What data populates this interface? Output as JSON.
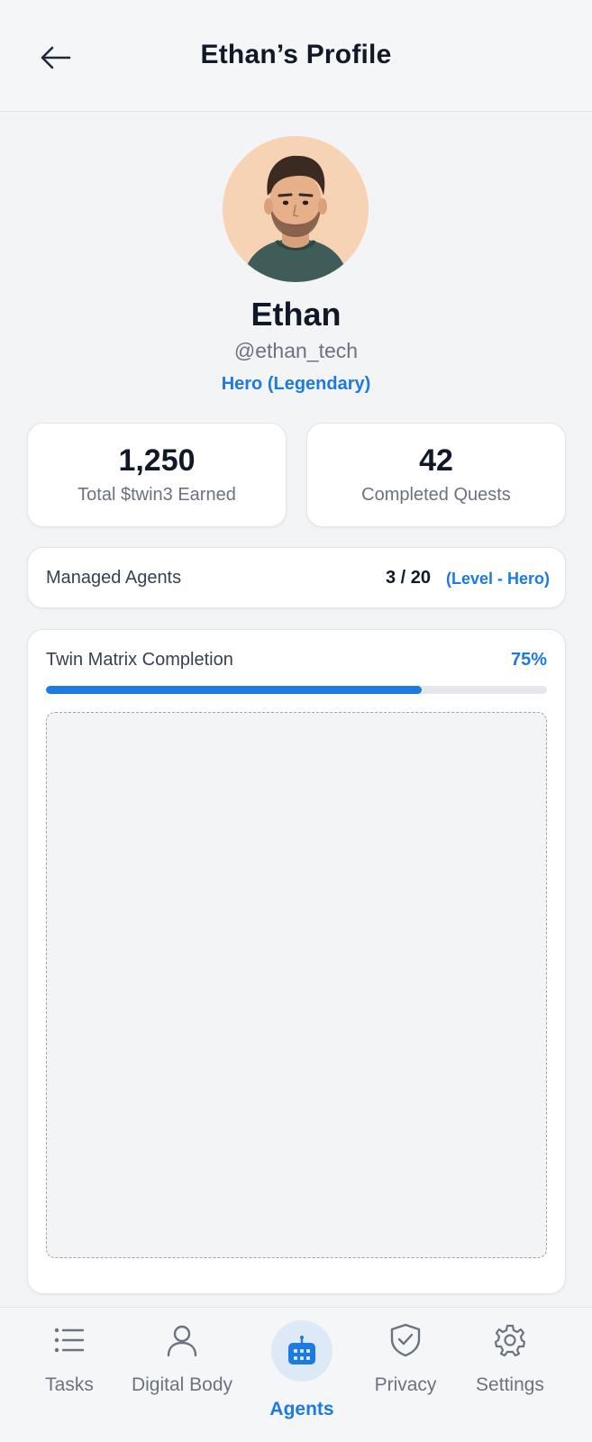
{
  "header": {
    "title": "Ethan’s Profile",
    "back_icon": "arrow-left-icon"
  },
  "profile": {
    "avatar_icon": "user-avatar",
    "name": "Ethan",
    "handle": "@ethan_tech",
    "rank": "Hero (Legendary)"
  },
  "stats": [
    {
      "value": "1,250",
      "label": "Total $twin3 Earned"
    },
    {
      "value": "42",
      "label": "Completed Quests"
    }
  ],
  "managed_agents": {
    "label": "Managed Agents",
    "count": "3 / 20",
    "level": "(Level - Hero)"
  },
  "twin_matrix": {
    "label": "Twin Matrix Completion",
    "percent_label": "75%",
    "progress": 0.75
  },
  "bottom_nav": {
    "items": [
      {
        "label": "Tasks",
        "icon": "list-icon"
      },
      {
        "label": "Digital Body",
        "icon": "person-icon"
      },
      {
        "label": "Agents",
        "icon": "robot-icon",
        "active": true
      },
      {
        "label": "Privacy",
        "icon": "shield-check-icon"
      },
      {
        "label": "Settings",
        "icon": "gear-icon"
      }
    ]
  },
  "colors": {
    "accent": "#1d7ae0",
    "background": "#f3f4f6",
    "card": "#ffffff",
    "text_primary": "#111827",
    "text_secondary": "#6b7280"
  }
}
